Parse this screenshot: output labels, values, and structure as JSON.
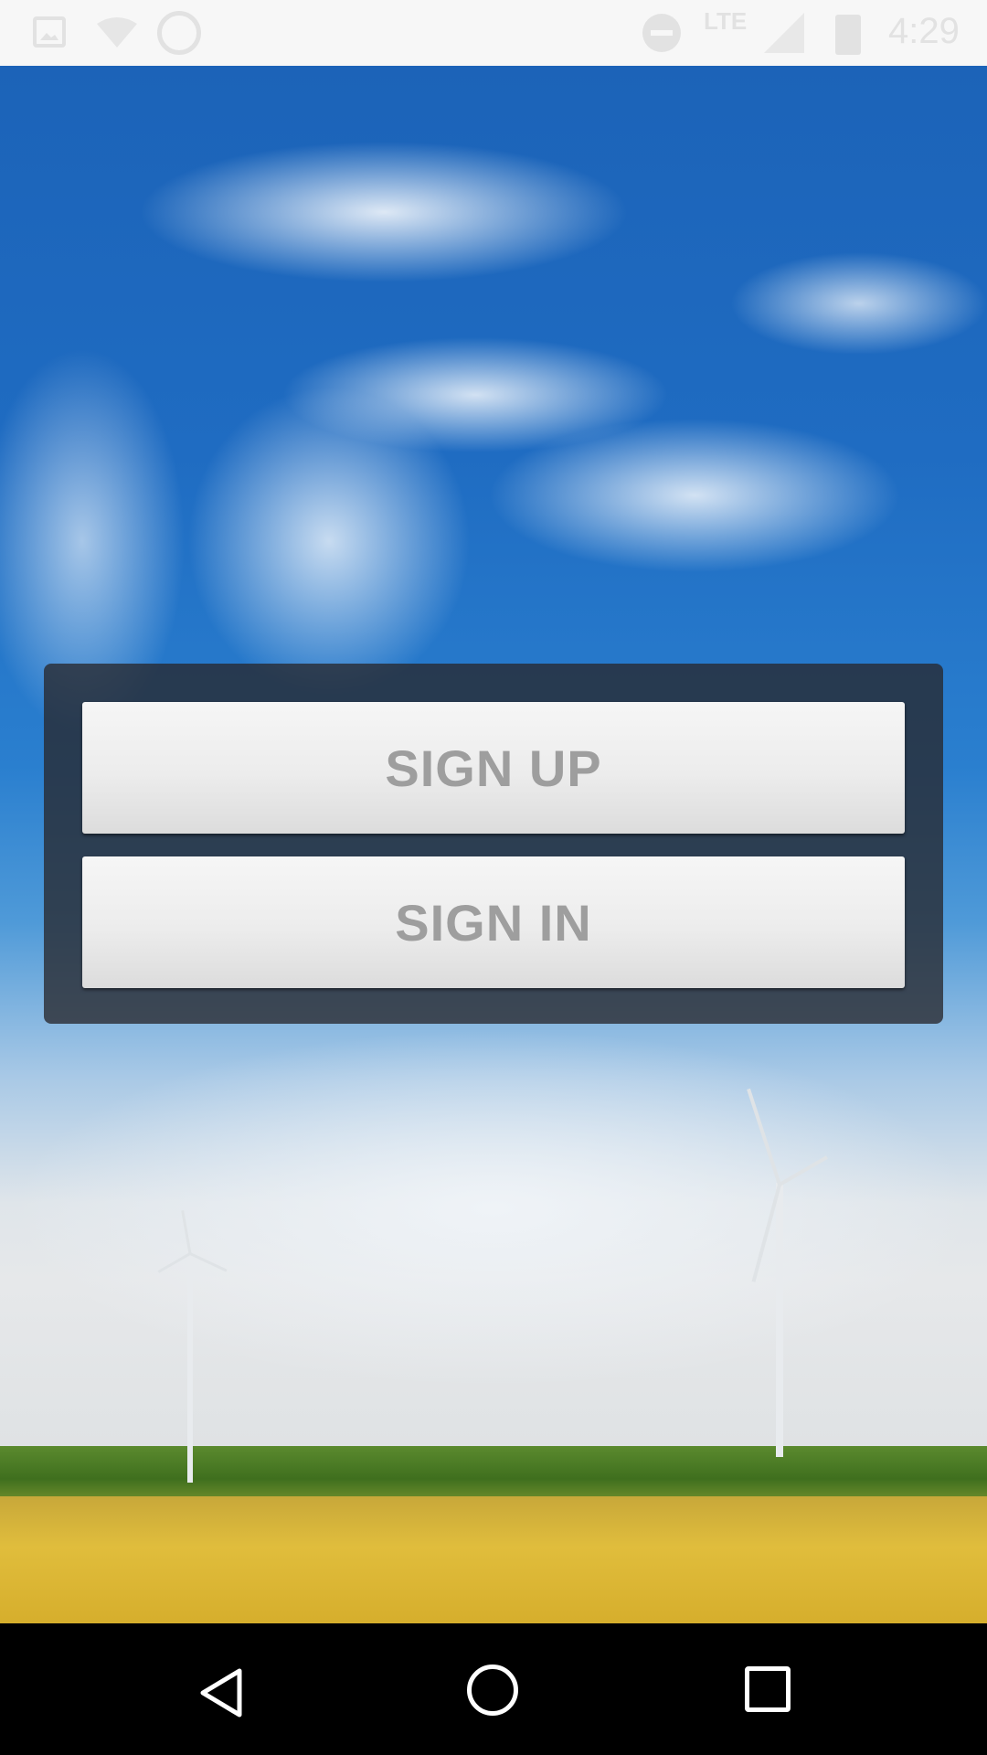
{
  "status_bar": {
    "time": "4:29",
    "network": "LTE",
    "icons": [
      "image-icon",
      "wifi-icon",
      "whatsapp-icon",
      "do-not-disturb-icon",
      "signal-icon",
      "battery-icon"
    ]
  },
  "auth": {
    "sign_up_label": "SIGN UP",
    "sign_in_label": "SIGN IN"
  },
  "nav_bar": {
    "icons": [
      "back-icon",
      "home-icon",
      "recents-icon"
    ]
  },
  "colors": {
    "sky": "#1f6cc2",
    "panel": "#28282d",
    "button_text": "#9e9e9e"
  }
}
